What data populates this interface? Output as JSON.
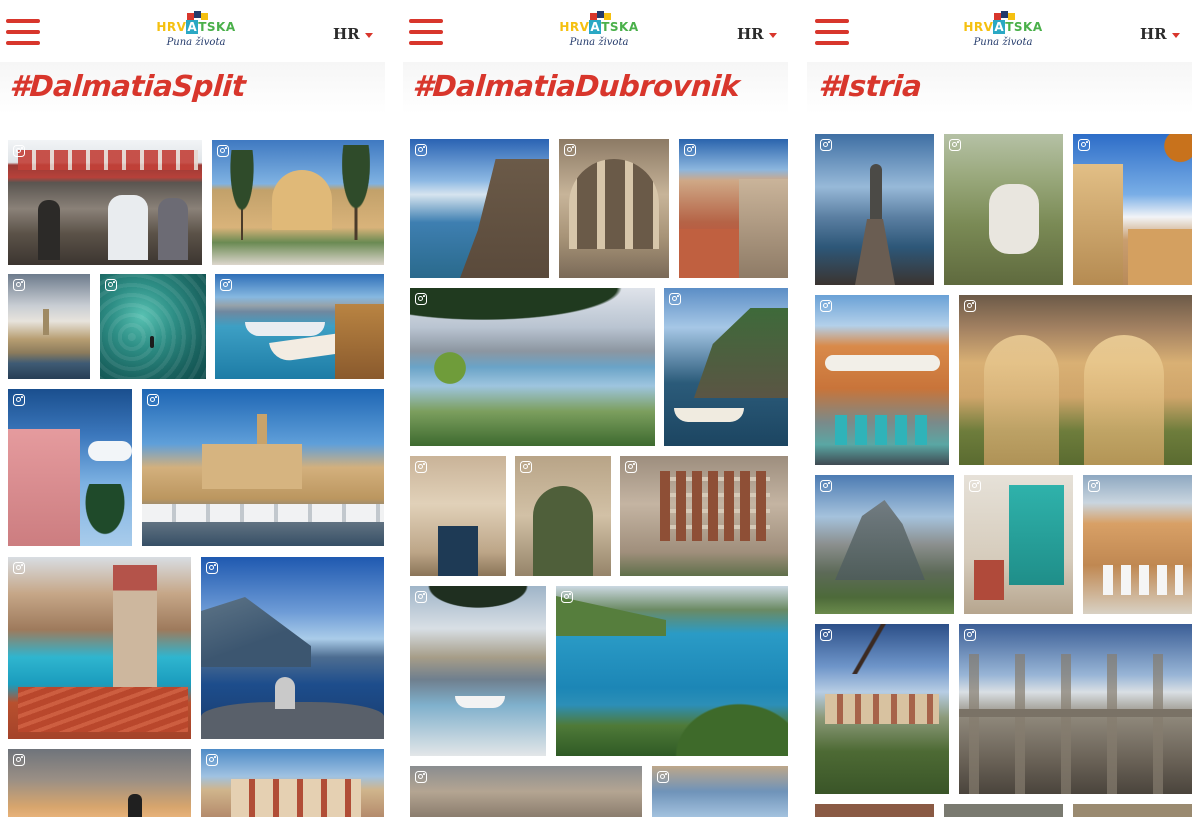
{
  "colors": {
    "brand_red": "#d8362c",
    "brand_navy": "#233a6b",
    "brand_yellow": "#f5c010",
    "brand_teal": "#2aa8c4",
    "brand_green": "#4ab04a"
  },
  "logo": {
    "word_left": "HRV",
    "word_mid": "A",
    "word_right": "TSKA",
    "tagline": "Puna života"
  },
  "icons": {
    "menu": "hamburger-menu-icon",
    "lang": "chevron-down-icon",
    "photo_badge": "instagram-icon"
  },
  "screens": [
    {
      "hashtag": "#DalmatiaSplit",
      "lang": "HR"
    },
    {
      "hashtag": "#DalmatiaDubrovnik",
      "lang": "HR"
    },
    {
      "hashtag": "#Istria",
      "lang": "HR"
    }
  ]
}
